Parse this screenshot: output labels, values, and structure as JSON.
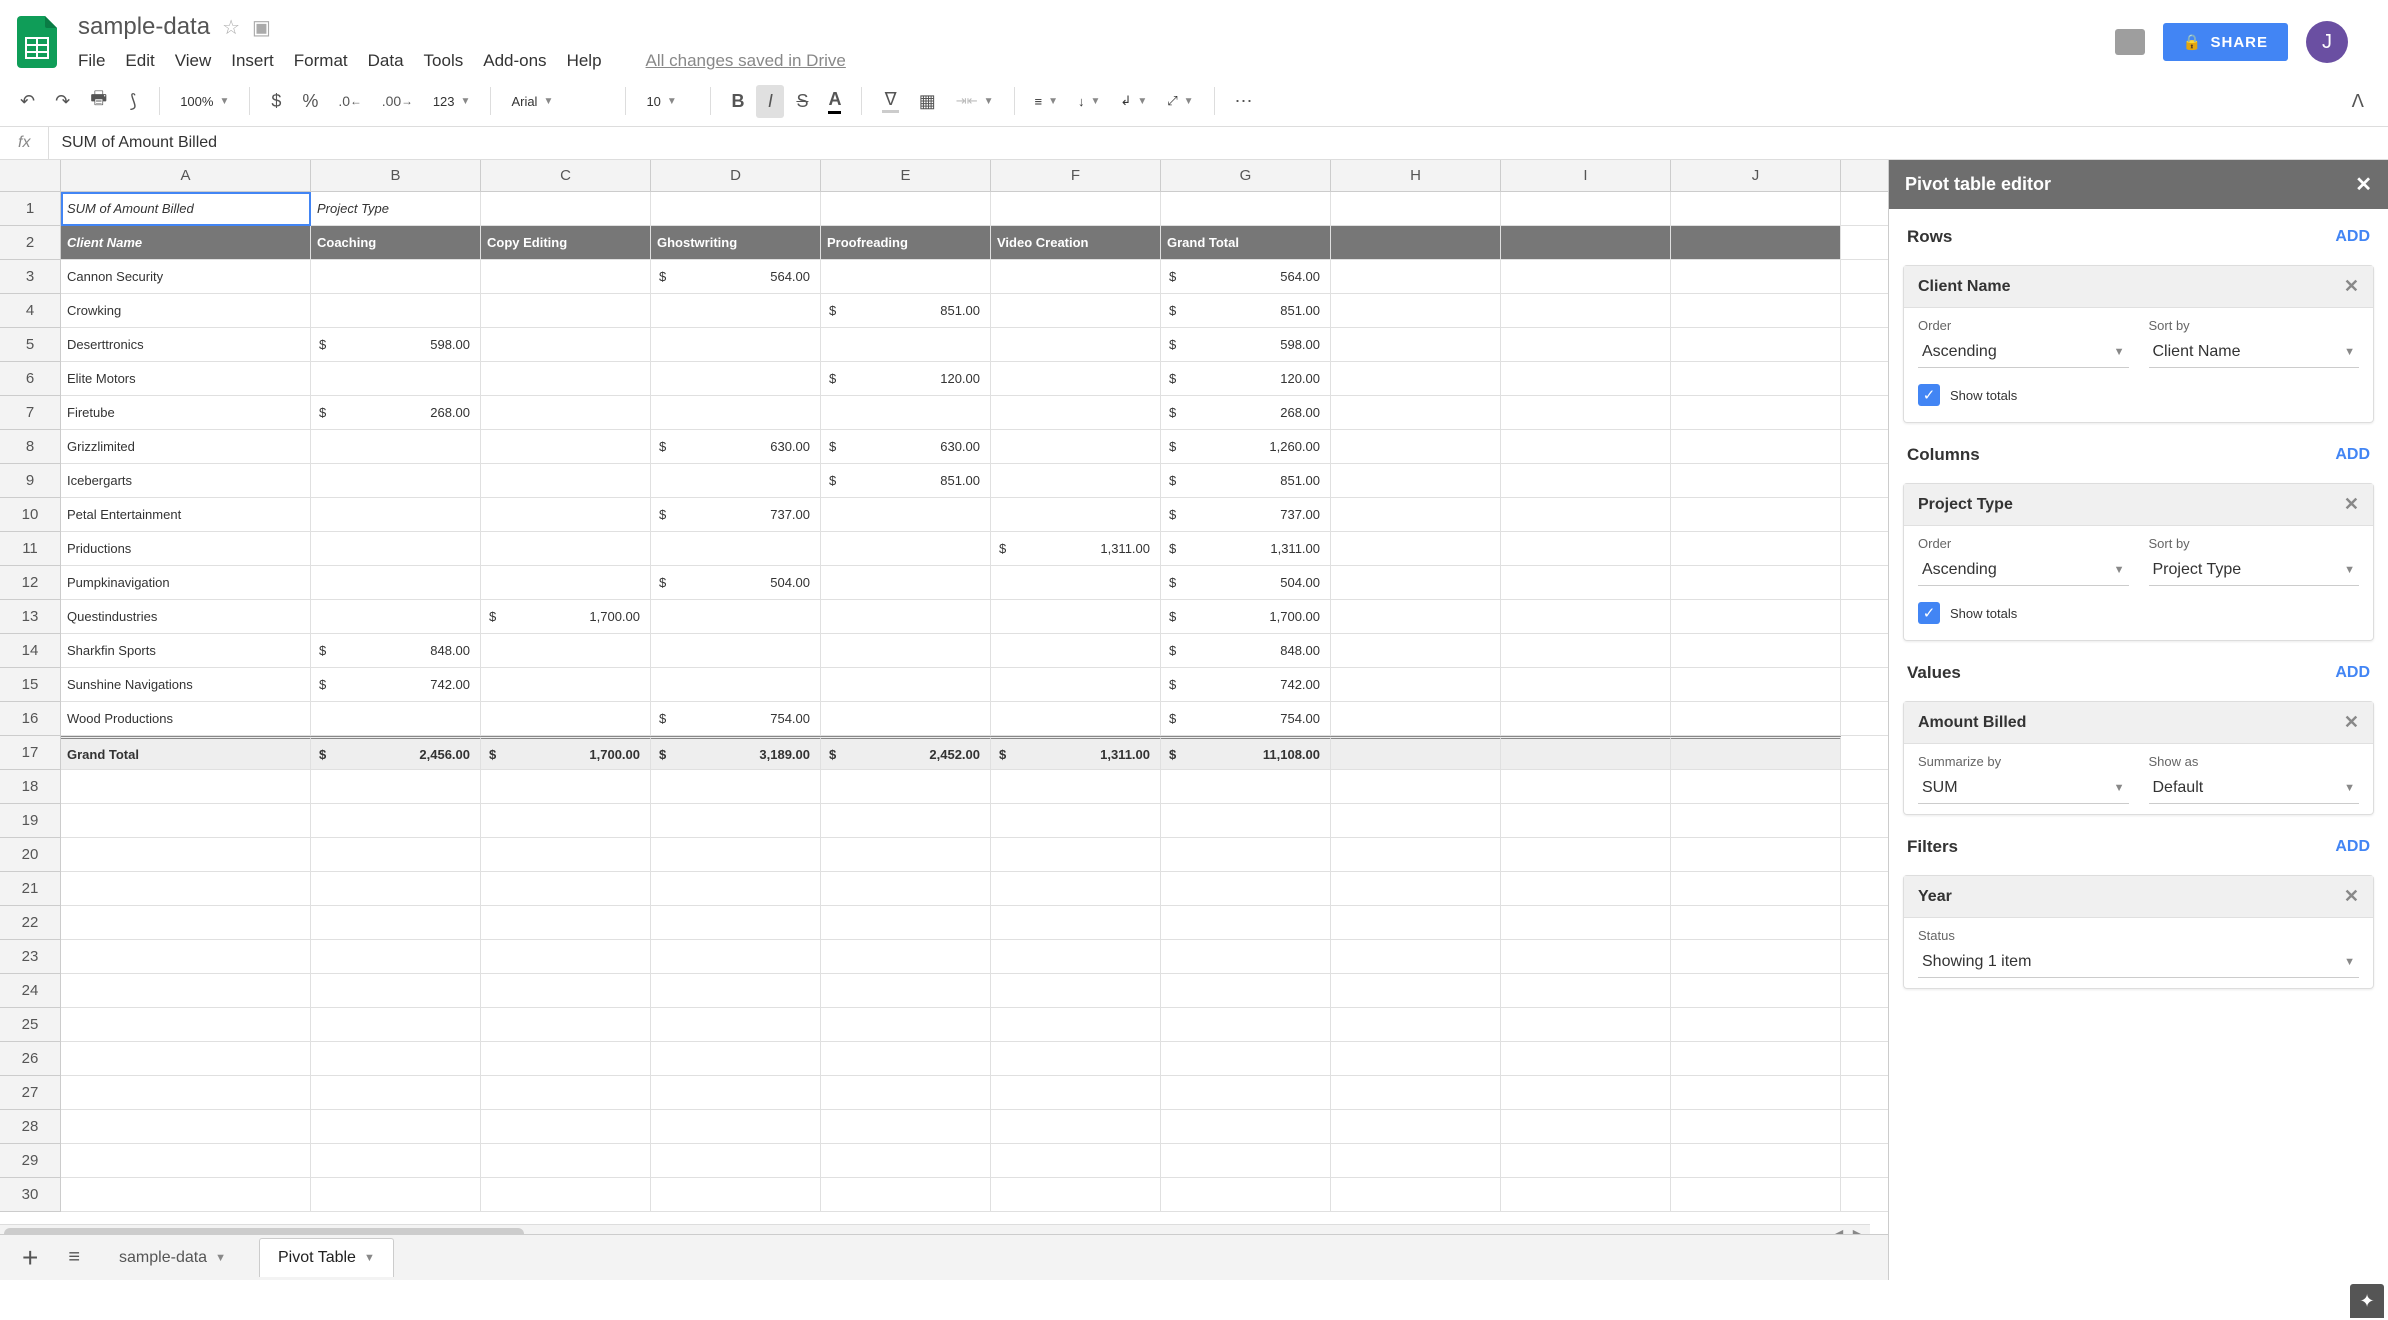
{
  "doc": {
    "title": "sample-data",
    "save_status": "All changes saved in Drive"
  },
  "menus": [
    "File",
    "Edit",
    "View",
    "Insert",
    "Format",
    "Data",
    "Tools",
    "Add-ons",
    "Help"
  ],
  "share": {
    "label": "SHARE"
  },
  "avatar": {
    "initial": "J"
  },
  "toolbar": {
    "zoom": "100%",
    "font": "Arial",
    "size": "10",
    "more_formats": "123"
  },
  "formula": {
    "value": "SUM of  Amount Billed"
  },
  "cols": [
    "A",
    "B",
    "C",
    "D",
    "E",
    "F",
    "G",
    "H",
    "I",
    "J"
  ],
  "row_count": 30,
  "pivot": {
    "r1": {
      "A": "SUM of  Amount Billed",
      "B": "Project Type"
    },
    "r2": {
      "A": "Client Name",
      "B": "Coaching",
      "C": "Copy Editing",
      "D": "Ghostwriting",
      "E": "Proofreading",
      "F": "Video Creation",
      "G": "Grand Total"
    },
    "data": [
      {
        "A": "Cannon Security",
        "D": "564.00",
        "G": "564.00"
      },
      {
        "A": "Crowking",
        "E": "851.00",
        "G": "851.00"
      },
      {
        "A": "Deserttronics",
        "B": "598.00",
        "G": "598.00"
      },
      {
        "A": "Elite Motors",
        "E": "120.00",
        "G": "120.00"
      },
      {
        "A": "Firetube",
        "B": "268.00",
        "G": "268.00"
      },
      {
        "A": "Grizzlimited",
        "D": "630.00",
        "E": "630.00",
        "G": "1,260.00"
      },
      {
        "A": "Icebergarts",
        "E": "851.00",
        "G": "851.00"
      },
      {
        "A": "Petal Entertainment",
        "D": "737.00",
        "G": "737.00"
      },
      {
        "A": "Priductions",
        "F": "1,311.00",
        "G": "1,311.00"
      },
      {
        "A": "Pumpkinavigation",
        "D": "504.00",
        "G": "504.00"
      },
      {
        "A": "Questindustries",
        "C": "1,700.00",
        "G": "1,700.00"
      },
      {
        "A": "Sharkfin Sports",
        "B": "848.00",
        "G": "848.00"
      },
      {
        "A": "Sunshine Navigations",
        "B": "742.00",
        "G": "742.00"
      },
      {
        "A": "Wood Productions",
        "D": "754.00",
        "G": "754.00"
      }
    ],
    "total": {
      "A": "Grand Total",
      "B": "2,456.00",
      "C": "1,700.00",
      "D": "3,189.00",
      "E": "2,452.00",
      "F": "1,311.00",
      "G": "11,108.00"
    }
  },
  "tabs": {
    "sample": "sample-data",
    "pivot": "Pivot Table"
  },
  "panel": {
    "title": "Pivot table editor",
    "rows_label": "Rows",
    "columns_label": "Columns",
    "values_label": "Values",
    "filters_label": "Filters",
    "add": "ADD",
    "client": {
      "title": "Client Name",
      "order_label": "Order",
      "order": "Ascending",
      "sort_label": "Sort by",
      "sort": "Client Name",
      "show_totals": "Show totals"
    },
    "project": {
      "title": "Project Type",
      "order_label": "Order",
      "order": "Ascending",
      "sort_label": "Sort by",
      "sort": "Project Type",
      "show_totals": "Show totals"
    },
    "amount": {
      "title": "Amount Billed",
      "sum_label": "Summarize by",
      "sum": "SUM",
      "show_label": "Show as",
      "show": "Default"
    },
    "year": {
      "title": "Year",
      "status_label": "Status",
      "status": "Showing 1 item"
    }
  }
}
